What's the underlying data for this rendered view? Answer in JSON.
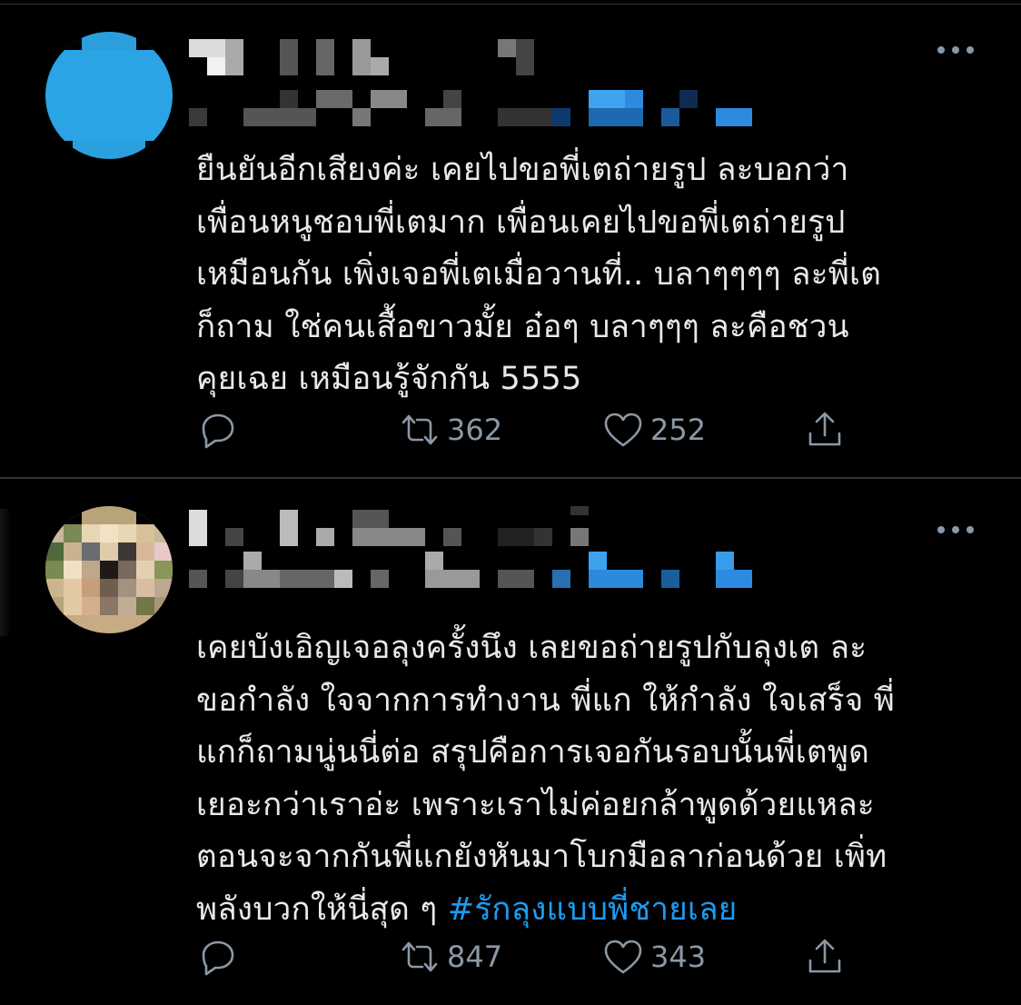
{
  "tweets": [
    {
      "text": "ยืนยันอีกเสียงค่ะ เคยไปขอพี่เตถ่ายรูป ละบอกว่า\nเพื่อนหนูชอบพี่เตมาก เพื่อนเคยไปขอพี่เตถ่ายรูป\nเหมือนกัน เพิ่งเจอพี่เตเมื่อวานที่.. บลาๆๆๆๆ ละพี่เต\nก็ถาม ใช่คนเสื้อขาวมั้ย อ๋อๆ บลาๆๆๆ ละคือชวน\nคุยเฉย เหมือนรู้จักกัน 5555",
      "hashtag": "",
      "retweets": "362",
      "likes": "252"
    },
    {
      "text": "เคยบังเอิญเจอลุงครั้งนึง เลยขอถ่ายรูปกับลุงเต ละ\nขอกำลัง ใจจากการทำงาน พี่แก ให้กำลัง ใจเสร็จ พี่\nแกก็ถามนู่นนี่ต่อ สรุปคือการเจอกันรอบนั้นพี่เตพูด\nเยอะกว่าเราอ่ะ เพราะเราไม่ค่อยกล้าพูดด้วยแหละ\nตอนจะจากกันพี่แกยังหันมาโบกมือลาก่อนด้วย เพิ่ท\nพลังบวกให้นี่สุด ๆ ",
      "hashtag": "#รักลุงแบบพี่ชายเลย",
      "retweets": "847",
      "likes": "343"
    }
  ],
  "icons": {
    "reply": "reply-icon",
    "retweet": "retweet-icon",
    "like": "heart-icon",
    "share": "share-icon",
    "more": "more-icon"
  },
  "colors": {
    "background": "#000000",
    "text": "#e7e9ea",
    "muted": "#8b98a5",
    "link": "#1d9bf0",
    "divider": "#2f3336"
  }
}
